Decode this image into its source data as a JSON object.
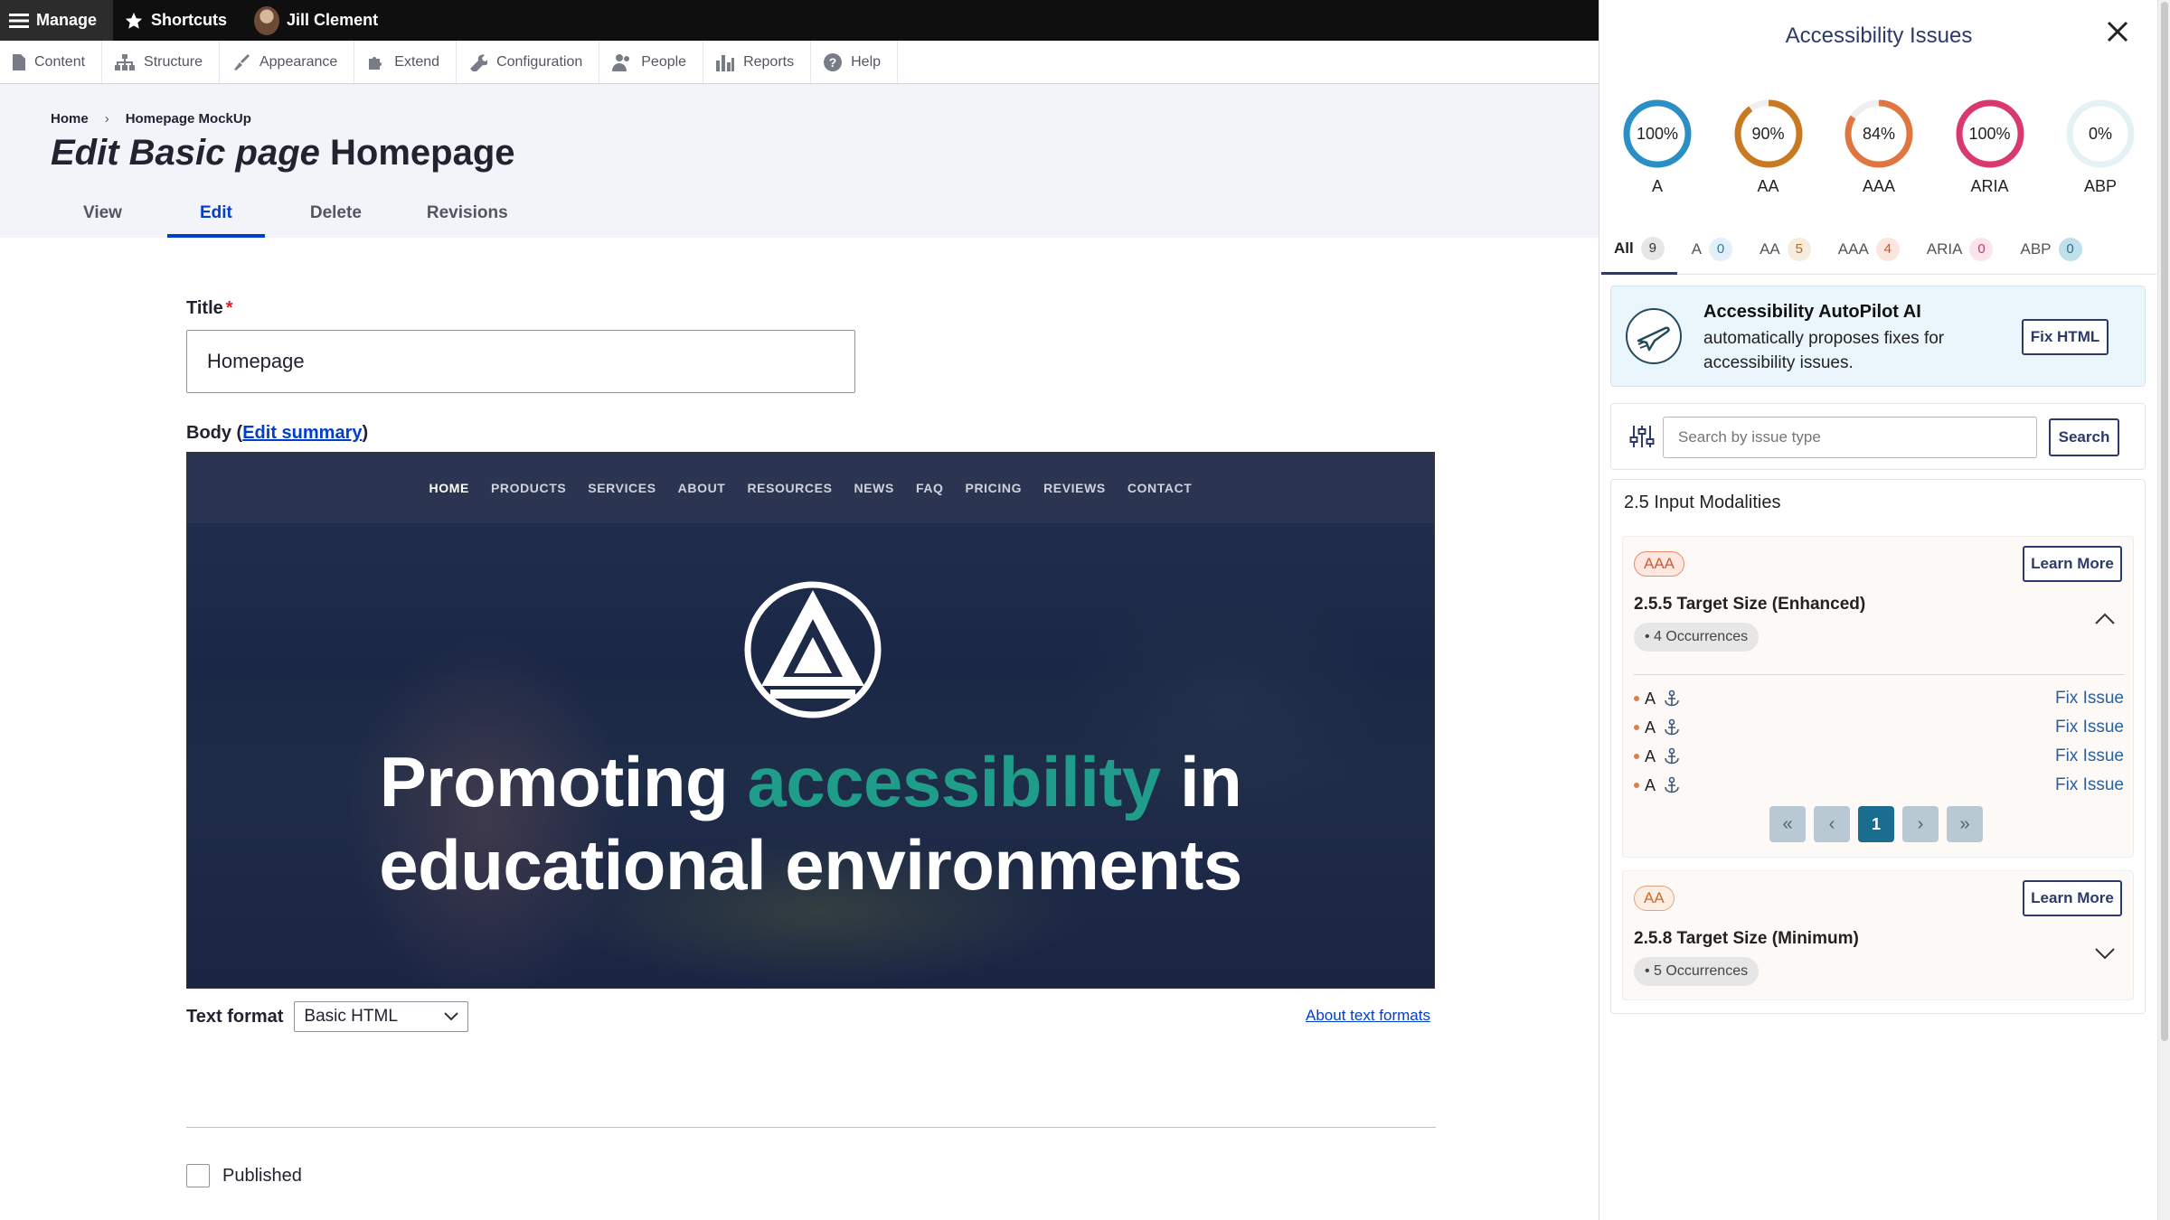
{
  "toolbar": {
    "manage": "Manage",
    "shortcuts": "Shortcuts",
    "user": "Jill Clement"
  },
  "tray": [
    {
      "label": "Content",
      "icon": "file-icon"
    },
    {
      "label": "Structure",
      "icon": "sitemap-icon"
    },
    {
      "label": "Appearance",
      "icon": "paintbrush-icon"
    },
    {
      "label": "Extend",
      "icon": "puzzle-icon"
    },
    {
      "label": "Configuration",
      "icon": "wrench-icon"
    },
    {
      "label": "People",
      "icon": "people-icon"
    },
    {
      "label": "Reports",
      "icon": "bar-chart-icon"
    },
    {
      "label": "Help",
      "icon": "help-icon"
    }
  ],
  "breadcrumb": [
    "Home",
    "Homepage MockUp"
  ],
  "page_title": {
    "prefix": "Edit Basic page",
    "name": "Homepage"
  },
  "tabs": [
    "View",
    "Edit",
    "Delete",
    "Revisions"
  ],
  "form": {
    "title_label": "Title",
    "title_value": "Homepage",
    "body_label": "Body",
    "edit_summary": "Edit summary",
    "text_format_label": "Text format",
    "text_format_value": "Basic HTML",
    "about_text_formats": "About text formats",
    "published_label": "Published"
  },
  "hero": {
    "nav": [
      "HOME",
      "PRODUCTS",
      "SERVICES",
      "ABOUT",
      "RESOURCES",
      "NEWS",
      "FAQ",
      "PRICING",
      "REVIEWS",
      "CONTACT"
    ],
    "line1_a": "Promoting",
    "line1_accent": "accessibility",
    "line1_b": "in",
    "line2": "educational environments",
    "accent_color": "#1f9d8a"
  },
  "panel": {
    "title": "Accessibility Issues",
    "scores": [
      {
        "value": "100%",
        "pct": 100,
        "label": "A",
        "color": "#2a8fc4"
      },
      {
        "value": "90%",
        "pct": 90,
        "label": "AA",
        "color": "#c97a20"
      },
      {
        "value": "84%",
        "pct": 84,
        "label": "AAA",
        "color": "#e0763f"
      },
      {
        "value": "100%",
        "pct": 100,
        "label": "ARIA",
        "color": "#d9396e"
      },
      {
        "value": "0%",
        "pct": 0,
        "label": "ABP",
        "color": "#b8dce6"
      }
    ],
    "tabs": [
      {
        "label": "All",
        "count": "9"
      },
      {
        "label": "A",
        "count": "0"
      },
      {
        "label": "AA",
        "count": "5"
      },
      {
        "label": "AAA",
        "count": "4"
      },
      {
        "label": "ARIA",
        "count": "0"
      },
      {
        "label": "ABP",
        "count": "0"
      }
    ],
    "autopilot": {
      "title": "Accessibility AutoPilot AI",
      "desc": "automatically proposes fixes for accessibility issues.",
      "button": "Fix HTML"
    },
    "search": {
      "placeholder": "Search by issue type",
      "button": "Search"
    },
    "group_title": "2.5 Input Modalities",
    "issues": [
      {
        "level": "AAA",
        "title": "2.5.5 Target Size (Enhanced)",
        "occurrences": "4 Occurrences",
        "learn_more": "Learn More",
        "rows": [
          {
            "label": "A",
            "action": "Fix Issue"
          },
          {
            "label": "A",
            "action": "Fix Issue"
          },
          {
            "label": "A",
            "action": "Fix Issue"
          },
          {
            "label": "A",
            "action": "Fix Issue"
          }
        ],
        "pager": {
          "first": "«",
          "prev": "‹",
          "current": "1",
          "next": "›",
          "last": "»"
        }
      },
      {
        "level": "AA",
        "title": "2.5.8 Target Size (Minimum)",
        "occurrences": "5 Occurrences",
        "learn_more": "Learn More"
      }
    ]
  }
}
